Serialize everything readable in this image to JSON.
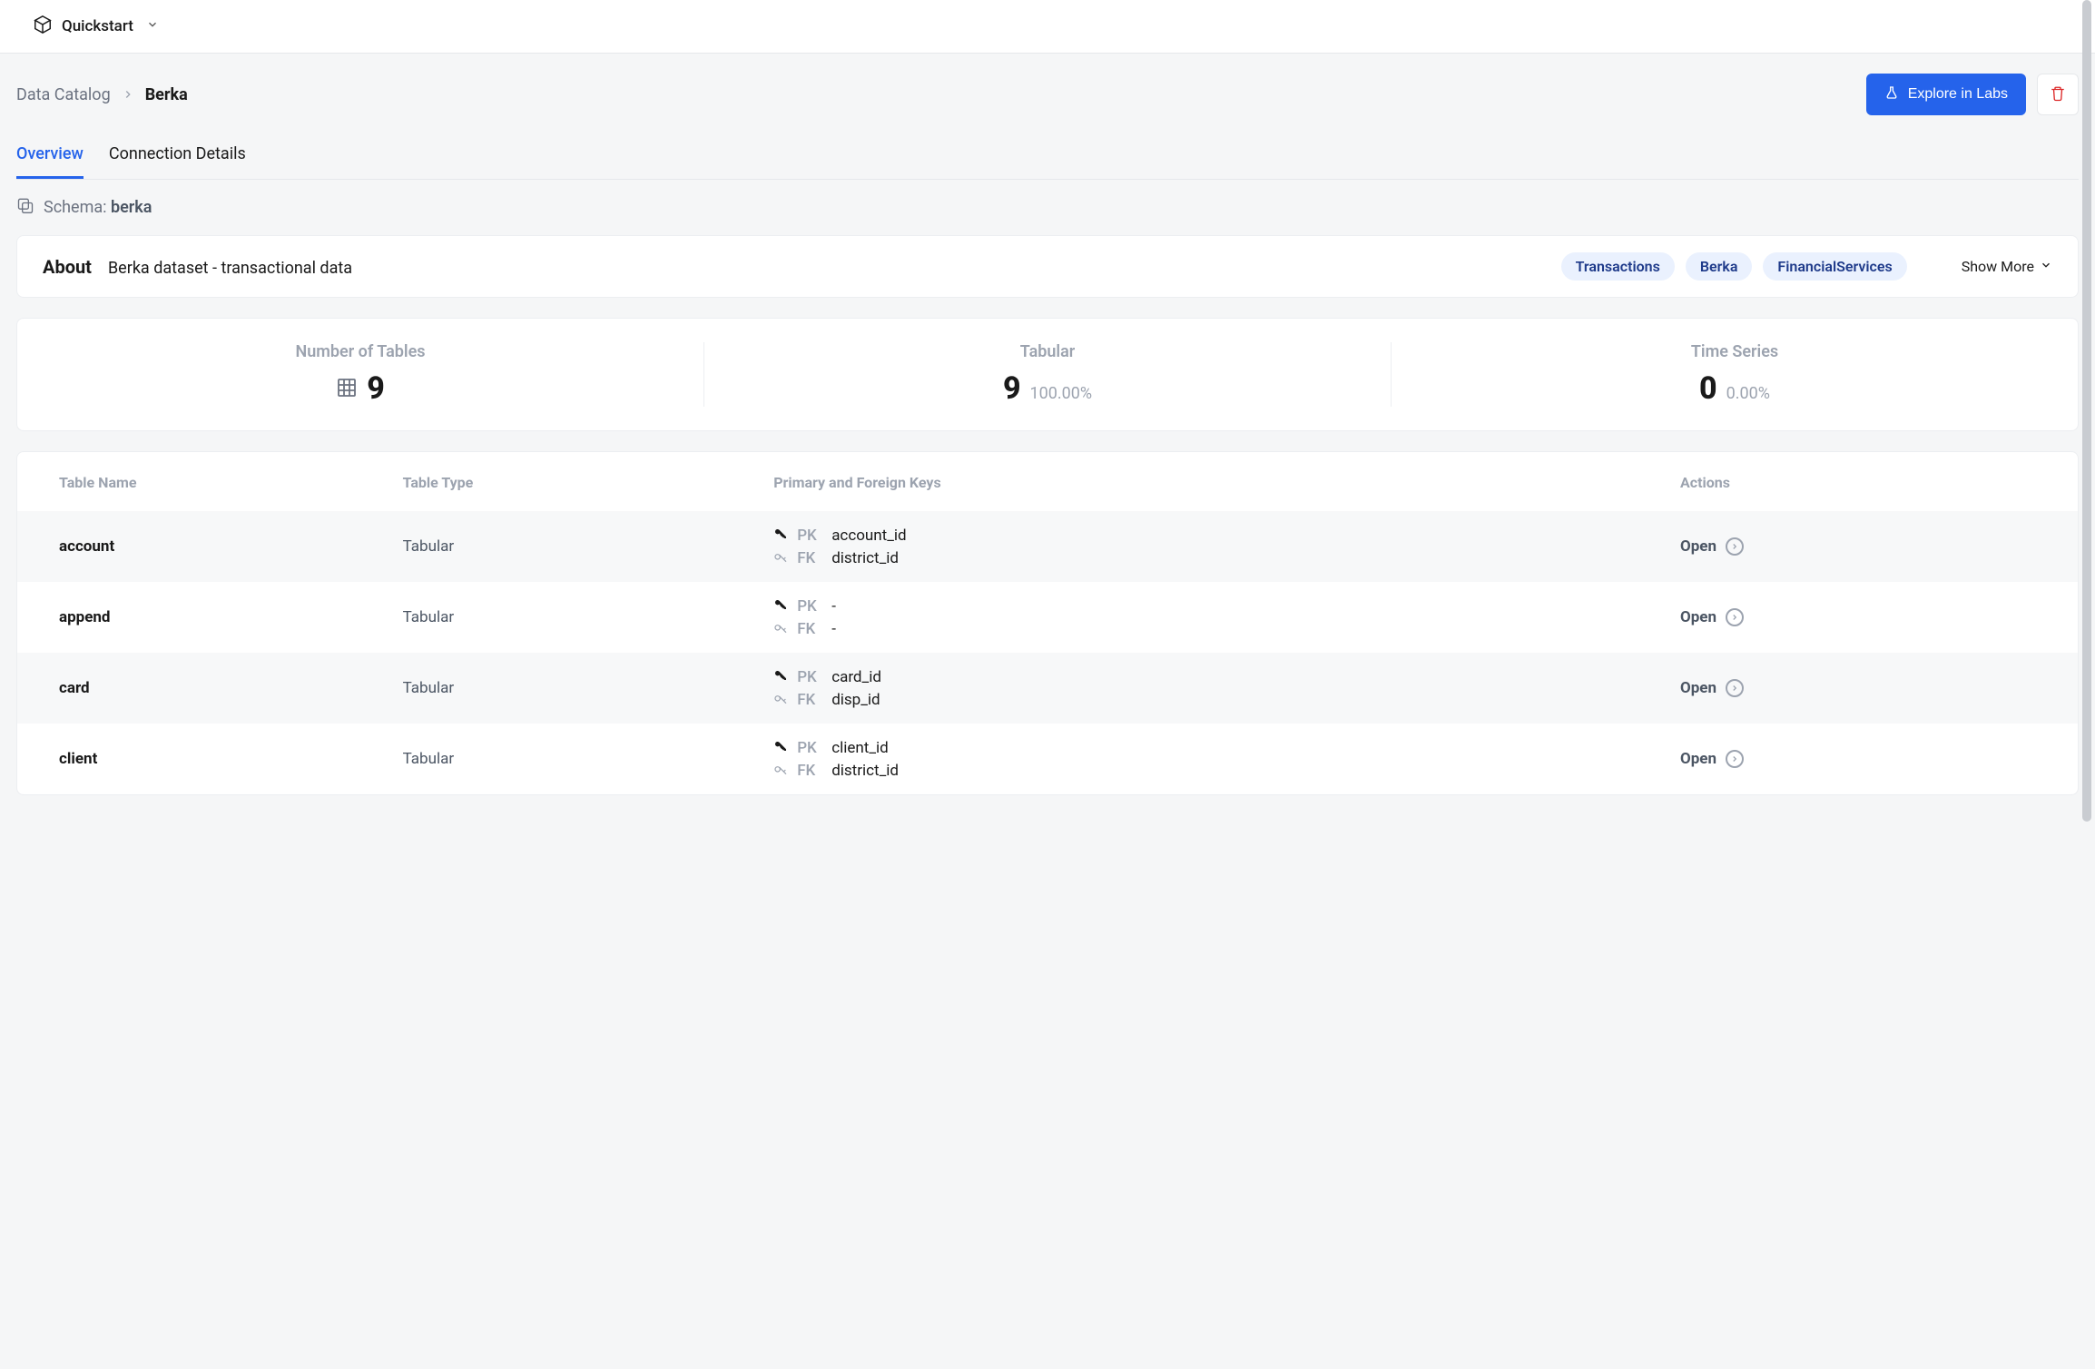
{
  "topbar": {
    "workspace": "Quickstart"
  },
  "breadcrumb": {
    "root": "Data Catalog",
    "current": "Berka"
  },
  "actions": {
    "explore_label": "Explore in Labs"
  },
  "tabs": {
    "overview": "Overview",
    "connection": "Connection Details"
  },
  "schema": {
    "label": "Schema: ",
    "name": "berka"
  },
  "about": {
    "label": "About",
    "description": "Berka dataset - transactional data",
    "tags": [
      "Transactions",
      "Berka",
      "FinancialServices"
    ],
    "show_more": "Show More"
  },
  "stats": {
    "num_tables": {
      "label": "Number of Tables",
      "value": "9"
    },
    "tabular": {
      "label": "Tabular",
      "value": "9",
      "pct": "100.00%"
    },
    "timeseries": {
      "label": "Time Series",
      "value": "0",
      "pct": "0.00%"
    }
  },
  "table_headers": {
    "name": "Table Name",
    "type": "Table Type",
    "keys": "Primary and Foreign Keys",
    "actions": "Actions"
  },
  "key_labels": {
    "pk": "PK",
    "fk": "FK"
  },
  "open_label": "Open",
  "rows": [
    {
      "name": "account",
      "type": "Tabular",
      "pk": "account_id",
      "fk": "district_id"
    },
    {
      "name": "append",
      "type": "Tabular",
      "pk": "-",
      "fk": "-"
    },
    {
      "name": "card",
      "type": "Tabular",
      "pk": "card_id",
      "fk": "disp_id"
    },
    {
      "name": "client",
      "type": "Tabular",
      "pk": "client_id",
      "fk": "district_id"
    }
  ]
}
